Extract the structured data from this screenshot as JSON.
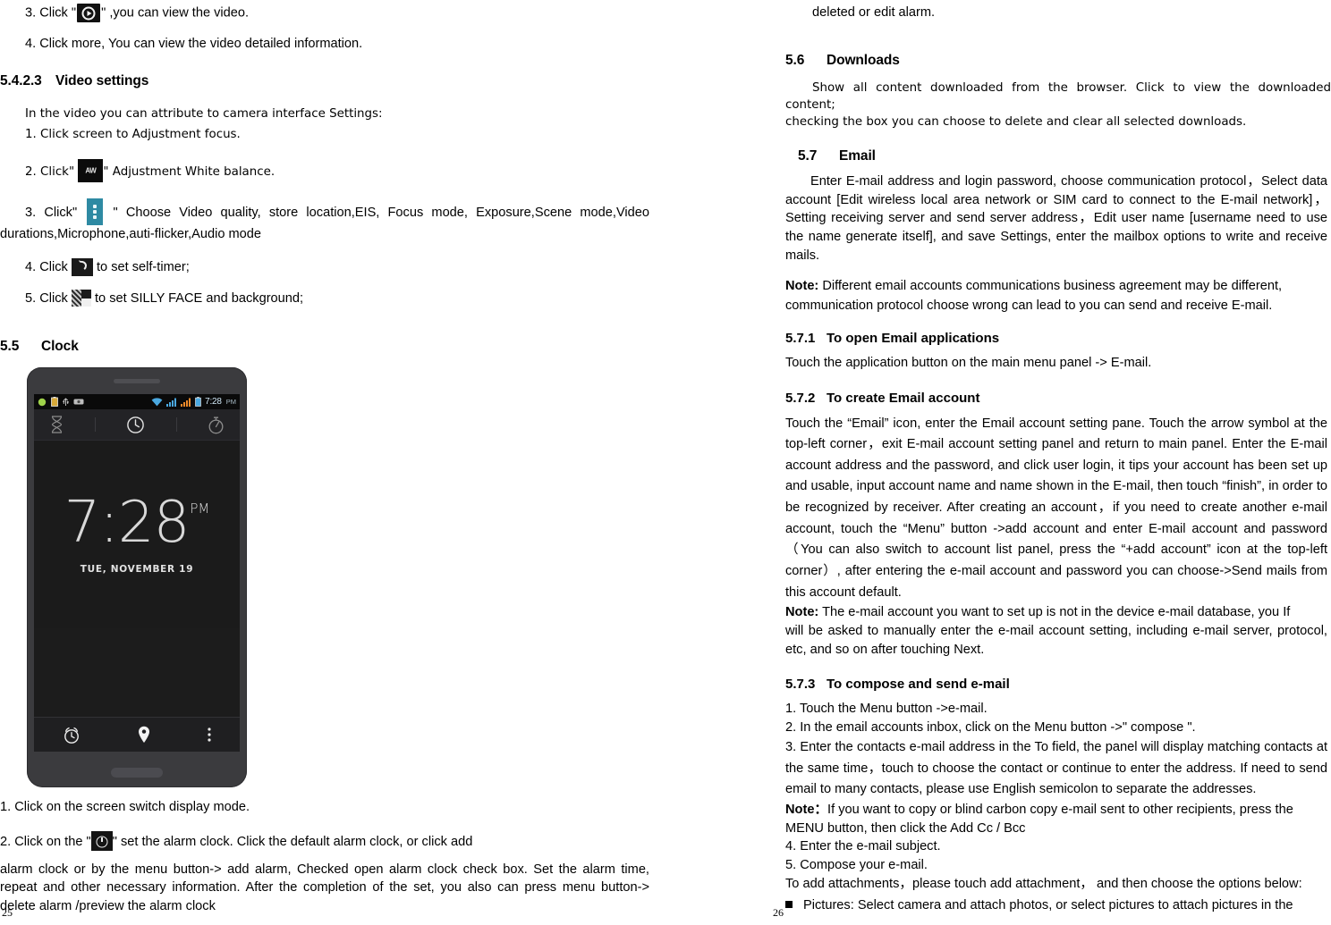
{
  "document": {
    "left_page_number": "25",
    "right_page_number": "26"
  },
  "left_column": {
    "step3_video_prefix": "3. Click \"",
    "step3_video_suffix": "\" ,you can view the video.",
    "step4_video": "4. Click more, You can view the video detailed information.",
    "heading_5423": {
      "num": "5.4.2.3",
      "title": "Video settings"
    },
    "video_settings_intro": "In the video you can attribute to camera interface Settings:",
    "vs_step1": "1. Click screen to Adjustment focus.",
    "vs_step2_prefix": "2. Click\"",
    "vs_step2_suffix": "\" Adjustment White balance.",
    "vs_step3_prefix": "3. Click\"",
    "vs_step3_suffix": "\" Choose Video quality, store location,EIS, Focus mode, Exposure,Scene mode,Video durations,Microphone,auti-flicker,Audio mode",
    "vs_step4_prefix": "4. Click",
    "vs_step4_suffix": "to set self-timer;",
    "vs_step5_prefix": "5. Click",
    "vs_step5_suffix": "to set SILLY FACE and background;",
    "heading_55": {
      "num": "5.5",
      "title": "Clock"
    },
    "clock_step1": "1. Click on the screen switch display mode.",
    "clock_step2_prefix": "2. Click on the \"",
    "clock_step2_suffix": "\" set the alarm clock. Click the default alarm clock, or click add",
    "clock_step2_rest": "alarm clock or by the menu button-> add alarm, Checked open alarm clock check box. Set the alarm time, repeat and other necessary information. After the completion of the set, you also can press menu button-> delete alarm /preview the alarm clock"
  },
  "phone_screenshot": {
    "status_bar": {
      "time": "7:28",
      "ampm": "PM",
      "left_icons": [
        "android-icon",
        "battery-charging-icon",
        "usb-icon",
        "screenshot-icon"
      ],
      "right_icons": [
        "wifi-icon",
        "signal-sim1-icon",
        "signal-sim2-icon",
        "battery-icon"
      ]
    },
    "tabs": [
      "timer-tab-icon",
      "clock-tab-icon",
      "stopwatch-tab-icon"
    ],
    "clock_time": "7:28",
    "clock_ampm": "PM",
    "clock_date": "TUE, NOVEMBER 19",
    "bottom_actions": [
      "alarm-icon",
      "location-pin-icon",
      "overflow-menu-icon"
    ]
  },
  "right_column": {
    "continued_line": "deleted or edit alarm.",
    "heading_56": {
      "num": "5.6",
      "title": "Downloads"
    },
    "downloads_p1": "Show all content downloaded from the browser. Click to view the downloaded content;",
    "downloads_p2": "checking the box you can choose to delete and clear all selected downloads.",
    "heading_57": {
      "num": "5.7",
      "title": "Email"
    },
    "email_intro": "Enter E-mail address and login password, choose communication protocol，Select data account [Edit wireless local area network or SIM card to connect to the E-mail network]，Setting receiving server and send server address，Edit user name [username need to use the name generate itself], and save Settings, enter the mailbox options to write and receive mails.",
    "email_note_label": "Note:",
    "email_note_text": " Different email accounts communications business agreement may be different, communication protocol choose wrong can lead to you can send and receive E-mail.",
    "heading_571": {
      "num": "5.7.1",
      "title": "To open Email applications"
    },
    "open_email_text": "Touch the application button on the main menu panel -> E-mail.",
    "heading_572": {
      "num": "5.7.2",
      "title": "To create Email account"
    },
    "create_email_text": "Touch the “Email” icon, enter the Email account setting pane. Touch the arrow symbol at the top-left corner，exit E-mail account setting panel and return to main panel. Enter the E-mail account address and the password, and click user login, it tips your account has been set up and usable, input account name and name shown in the E-mail, then touch “finish”, in order to be recognized by receiver. After creating an account，if you need to create another e-mail account, touch the “Menu” button ->add account and enter E-mail account and password（You can also switch to account list panel, press the “+add account” icon at the top-left corner）, after entering the e-mail account and password you can choose->Send mails from this account default.",
    "create_note_label": "Note:",
    "create_note_text": " The e-mail account you want to set up is not in the device e-mail database, you If",
    "create_note_text2": "will be asked to manually enter the e-mail account setting, including e-mail server, protocol, etc, and so on after touching Next.",
    "heading_573": {
      "num": "5.7.3",
      "title": "To compose and send e-mail"
    },
    "compose_step1": "1. Touch the Menu button ->e-mail.",
    "compose_step2": "2. In the email accounts inbox, click on the Menu button ->\" compose \".",
    "compose_step3": "3. Enter the contacts e-mail address in the To field, the panel will display matching contacts at the same time，touch to choose the contact or continue to enter the address. If need to send email to many contacts, please use English semicolon to separate the addresses.",
    "compose_note_label": "Note：",
    "compose_note_text": "If you want to copy or blind carbon copy e-mail sent to other recipients, press the MENU button, then click the Add Cc / Bcc",
    "compose_step4": "4. Enter the e-mail subject.",
    "compose_step5": "5. Compose your e-mail.",
    "attachments_line": "To add attachments，please touch add attachment，  and then choose the options below:",
    "pictures_bullet": "Pictures: Select camera and attach photos, or select pictures to attach pictures in the"
  },
  "colors": {
    "accent_blue": "#2e8aa3",
    "phone_body": "#3b3b3e",
    "screen_bg": "#1b1b1b",
    "status_bg": "#0a0a0a",
    "status_time": "#cfe6f5"
  }
}
